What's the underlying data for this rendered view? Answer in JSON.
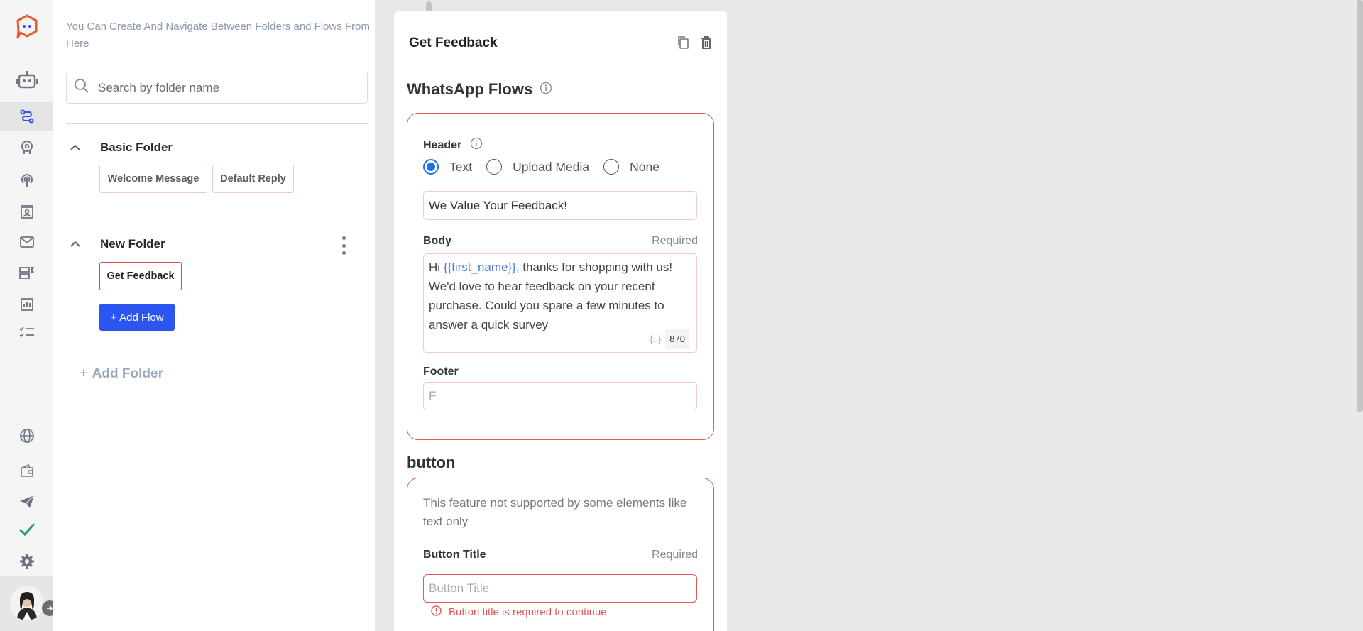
{
  "sidebar": {
    "items": [
      {
        "icon": "bot-icon"
      },
      {
        "icon": "flows-icon",
        "active": true
      },
      {
        "icon": "brain-icon"
      },
      {
        "icon": "broadcast-icon"
      },
      {
        "icon": "contacts-icon"
      },
      {
        "icon": "mail-icon"
      },
      {
        "icon": "templates-icon"
      },
      {
        "icon": "analytics-icon"
      },
      {
        "icon": "tasks-icon"
      },
      {
        "icon": "globe-icon"
      },
      {
        "icon": "wallet-icon"
      },
      {
        "icon": "send-icon"
      },
      {
        "icon": "check-icon"
      },
      {
        "icon": "settings-icon"
      }
    ],
    "accent": "#f0572a"
  },
  "folders_panel": {
    "hint": "You Can Create And Navigate Between Folders and Flows From Here",
    "search_placeholder": "Search by folder name",
    "folders": [
      {
        "name": "Basic Folder",
        "flows": [
          "Welcome Message",
          "Default Reply"
        ]
      },
      {
        "name": "New Folder",
        "flows": [
          "Get Feedback"
        ],
        "add_flow_label": "Add Flow"
      }
    ],
    "add_folder_label": "Add Folder"
  },
  "editor": {
    "title": "Get Feedback",
    "section_flows": "WhatsApp Flows",
    "header_label": "Header",
    "header_options": [
      "Text",
      "Upload Media",
      "None"
    ],
    "header_selected": "Text",
    "header_value": "We Value Your Feedback!",
    "body_label": "Body",
    "required_label": "Required",
    "body_prefix": "Hi ",
    "body_variable": "{{first_name}}",
    "body_suffix": ", thanks for shopping with us! We'd love to hear feedback on your recent purchase. Could you spare a few minutes to answer a quick survey",
    "variable_braces": "{..}",
    "char_count": "870",
    "footer_label": "Footer",
    "footer_placeholder": "F",
    "section_button": "button",
    "button_note": "This feature not supported by some elements like text only",
    "button_title_label": "Button Title",
    "button_title_placeholder": "Button Title",
    "button_error": "Button title is required to continue",
    "error_color": "#e05757",
    "primary_color": "#2c55f0"
  }
}
